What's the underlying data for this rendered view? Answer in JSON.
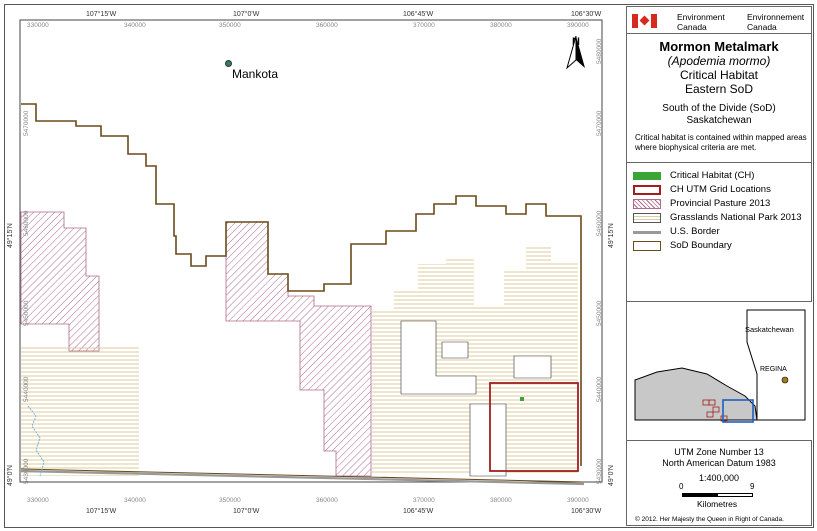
{
  "map": {
    "place_name": "Mankota",
    "north_label": "N",
    "top_lon_ticks": [
      "107°15'W",
      "107°0'W",
      "106°45'W",
      "106°30'W"
    ],
    "bottom_lon_ticks": [
      "107°15'W",
      "107°0'W",
      "106°45'W",
      "106°30'W"
    ],
    "top_utm_ticks": [
      "330000",
      "340000",
      "350000",
      "360000",
      "370000",
      "380000",
      "390000"
    ],
    "bottom_utm_ticks": [
      "330000",
      "340000",
      "350000",
      "360000",
      "370000",
      "380000",
      "390000"
    ],
    "left_lat_ticks": [
      "49°15'N",
      "49°0'N"
    ],
    "right_lat_ticks": [
      "49°15'N",
      "49°0'N"
    ],
    "left_utm_ticks": [
      "5470000",
      "5460000",
      "5450000",
      "5440000",
      "5430000"
    ],
    "right_utm_ticks": [
      "5480000",
      "5470000",
      "5460000",
      "5450000",
      "5440000",
      "5430000"
    ]
  },
  "agency": {
    "name_en_1": "Environment",
    "name_en_2": "Canada",
    "name_fr_1": "Environnement",
    "name_fr_2": "Canada"
  },
  "title": {
    "common_name": "Mormon Metalmark",
    "scientific_name": "(Apodemia mormo)",
    "line_3": "Critical Habitat",
    "line_4": "Eastern SoD",
    "region_1": "South of the Divide (SoD)",
    "region_2": "Saskatchewan",
    "note": "Critical habitat is contained within mapped areas where biophysical criteria are met."
  },
  "legend": {
    "items": [
      {
        "label": "Critical Habitat (CH)",
        "color": "#3aa535"
      },
      {
        "label": "CH UTM Grid Locations",
        "color": "#a31f1f"
      },
      {
        "label": "Provincial Pasture 2013",
        "color": "#b06a8a"
      },
      {
        "label": "Grasslands National Park 2013",
        "color": "#d9cfa0"
      },
      {
        "label": "U.S. Border",
        "color": "#999999"
      },
      {
        "label": "SoD Boundary",
        "color": "#6b4a1b"
      }
    ]
  },
  "inset": {
    "province_label": "Saskatchewan",
    "city_label": "REGINA"
  },
  "datum": {
    "zone": "UTM Zone Number 13",
    "datum": "North American Datum 1983",
    "scale": "1:400,000",
    "scale_start": "0",
    "scale_end": "9",
    "unit": "Kilometres",
    "copyright": "© 2012. Her Majesty the Queen in Right of Canada."
  }
}
